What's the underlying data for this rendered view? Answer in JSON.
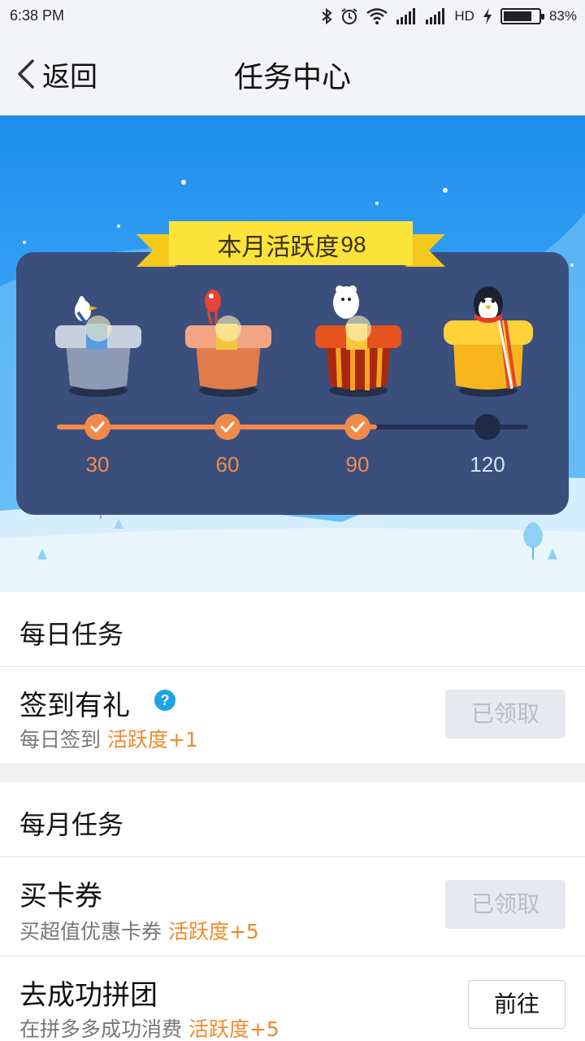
{
  "status_bar": {
    "time": "6:38 PM",
    "network": "HD",
    "battery_percent": "83%",
    "battery_level": 0.83,
    "icons": [
      "bluetooth-icon",
      "alarm-icon",
      "wifi-icon",
      "signal-icon",
      "signal-icon",
      "charging-icon",
      "battery-icon"
    ]
  },
  "nav": {
    "back_label": "返回",
    "title": "任务中心"
  },
  "banner": {
    "title": "本月活跃度",
    "activity_value": "98",
    "progress_fraction": 0.68,
    "colors": {
      "accent": "#f08a4b",
      "panel": "#3b4f7c",
      "ribbon": "#f7de2a",
      "sky": "#2196f3"
    },
    "milestones": [
      {
        "label": "30",
        "reached": true,
        "chest": "blue-gift-chest-icon",
        "mascot": "seagull-icon"
      },
      {
        "label": "60",
        "reached": true,
        "chest": "orange-gift-chest-icon",
        "mascot": "parrot-icon"
      },
      {
        "label": "90",
        "reached": true,
        "chest": "red-gift-chest-icon",
        "mascot": "polar-bear-icon"
      },
      {
        "label": "120",
        "reached": false,
        "chest": "gold-gift-chest-icon",
        "mascot": "penguin-icon"
      }
    ]
  },
  "daily": {
    "header": "每日任务",
    "tasks": [
      {
        "title": "签到有礼",
        "help": "?",
        "desc": "每日签到",
        "reward": "活跃度+1",
        "button": "已领取"
      }
    ]
  },
  "monthly": {
    "header": "每月任务",
    "tasks": [
      {
        "title": "买卡券",
        "desc": "买超值优惠卡券",
        "reward": "活跃度+5",
        "button": "已领取"
      },
      {
        "title": "去成功拼团",
        "desc": "在拼多多成功消费",
        "reward": "活跃度+5",
        "button": "前往"
      }
    ]
  }
}
